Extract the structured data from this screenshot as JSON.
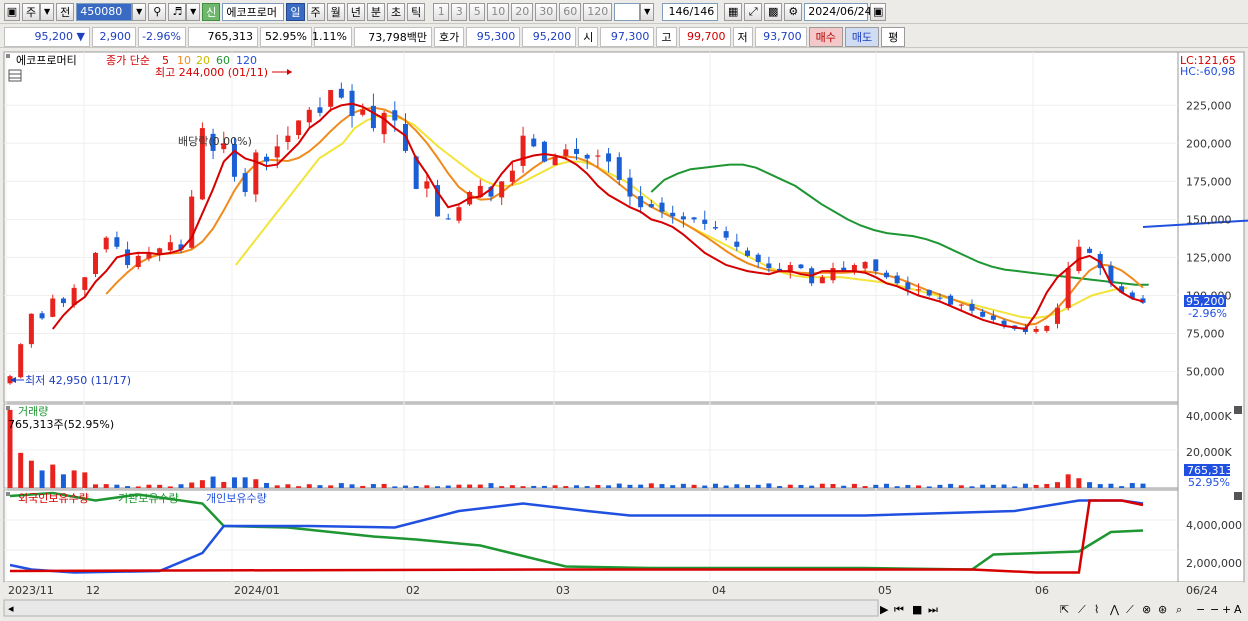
{
  "toolbar": {
    "period_btn": "주",
    "prev_btn": "전",
    "code": "450080",
    "new_badge": "신",
    "stock_name": "에코프로머",
    "periods": [
      "일",
      "주",
      "월",
      "년",
      "분",
      "초",
      "틱"
    ],
    "selected_period": "일",
    "intervals": [
      "1",
      "3",
      "5",
      "10",
      "20",
      "30",
      "60",
      "120"
    ],
    "count": "146",
    "count_total": "/146",
    "date": "2024/06/24"
  },
  "quote": {
    "price": "95,200",
    "arrow": "▼",
    "change": "2,900",
    "change_pct": "-2.96%",
    "volume": "765,313",
    "turnover_pct": "52.95%",
    "vol_ratio": "1.11%",
    "amount": "73,798백만",
    "hoga_label": "호가",
    "ask": "95,300",
    "bid": "95,200",
    "open_label": "시",
    "open": "97,300",
    "high_label": "고",
    "high": "99,700",
    "low_label": "저",
    "low": "93,700",
    "buy_btn": "매수",
    "sell_btn": "매도",
    "avg_btn": "평"
  },
  "price_panel": {
    "legend_name": "에코프로머티",
    "legend_ma_title": "종가 단순",
    "legend_ma": [
      {
        "label": "5",
        "color": "#D60000"
      },
      {
        "label": "10",
        "color": "#F08A1C"
      },
      {
        "label": "20",
        "color": "#F2E43A"
      },
      {
        "label": "60",
        "color": "#1E9632"
      },
      {
        "label": "120",
        "color": "#2050E0"
      }
    ],
    "high_note": "최고 244,000 (01/11)",
    "low_note": "최저 42,950 (11/17)",
    "div_note": "배당락(0.00%)",
    "lc": "LC:121,65",
    "hc": "HC:-60,98",
    "current_tag": "95,200",
    "current_pct": "-2.96%",
    "yticks": [
      "225,000",
      "200,000",
      "175,000",
      "150,000",
      "125,000",
      "100,000",
      "75,000",
      "50,000"
    ]
  },
  "volume_panel": {
    "title": "거래량",
    "value_note": "765,313주(52.95%)",
    "yticks": [
      "40,000K",
      "20,000K"
    ],
    "current_tag": "765,313",
    "current_pct": "52.95%"
  },
  "holdings_panel": {
    "legend": [
      {
        "label": "외국인보유수량",
        "color": "#D60000"
      },
      {
        "label": "기관보유수량",
        "color": "#1E9632"
      },
      {
        "label": "개인보유수량",
        "color": "#2050E0"
      }
    ],
    "yticks": [
      "4,000,000",
      "2,000,000"
    ]
  },
  "xaxis": {
    "labels": [
      "2023/11",
      "12",
      "2024/01",
      "02",
      "03",
      "04",
      "05",
      "06"
    ],
    "end_label": "06/24"
  },
  "chart_data": {
    "type": "candlestick",
    "title": "에코프로머티",
    "dates_range": [
      "2023/11/17",
      "2024/06/24"
    ],
    "ylim": [
      30000,
      260000
    ],
    "close": [
      47000,
      68000,
      88000,
      85000,
      98000,
      95000,
      105000,
      112000,
      128000,
      138000,
      132000,
      120000,
      126000,
      128000,
      131000,
      135000,
      130000,
      165000,
      210000,
      195000,
      200000,
      178000,
      168000,
      194000,
      188000,
      198000,
      205000,
      215000,
      222000,
      220000,
      235000,
      230000,
      218000,
      222000,
      210000,
      220000,
      215000,
      195000,
      170000,
      175000,
      152000,
      150000,
      158000,
      168000,
      172000,
      165000,
      175000,
      182000,
      205000,
      198000,
      188000,
      191000,
      196000,
      193000,
      190000,
      192000,
      188000,
      176000,
      165000,
      158000,
      158000,
      155000,
      152000,
      150000,
      150000,
      147000,
      144000,
      138000,
      132000,
      126000,
      122000,
      118000,
      116000,
      120000,
      118000,
      108000,
      112000,
      118000,
      116000,
      120000,
      122000,
      116000,
      112000,
      108000,
      104000,
      104000,
      100000,
      98000,
      94000,
      94000,
      90000,
      86000,
      84000,
      80000,
      78000,
      76000,
      78000,
      80000,
      92000,
      118000,
      132000,
      128000,
      118000,
      108000,
      102000,
      98000,
      95200
    ],
    "ma5": [
      null,
      null,
      null,
      null,
      78000,
      87000,
      94000,
      99000,
      109000,
      116000,
      125000,
      127000,
      128000,
      128000,
      127000,
      128000,
      130000,
      138000,
      154000,
      170000,
      188000,
      195000,
      190000,
      188000,
      185000,
      186000,
      193000,
      200000,
      210000,
      215000,
      222000,
      225000,
      226000,
      224000,
      220000,
      216000,
      210000,
      205000,
      190000,
      180000,
      168000,
      158000,
      160000,
      164000,
      165000,
      170000,
      180000,
      188000,
      190000,
      192000,
      193000,
      192000,
      190000,
      186000,
      180000,
      172000,
      166000,
      162000,
      158000,
      155000,
      150000,
      148000,
      145000,
      140000,
      134000,
      128000,
      124000,
      120000,
      118000,
      116000,
      115000,
      114000,
      116000,
      116000,
      114000,
      113000,
      116000,
      116000,
      116000,
      116000,
      115000,
      112000,
      108000,
      106000,
      103000,
      100000,
      98000,
      96000,
      93000,
      90000,
      87000,
      84000,
      82000,
      80000,
      79000,
      78000,
      88000,
      102000,
      112000,
      118000,
      124000,
      126000,
      122000,
      108000,
      102000,
      98000,
      96000
    ],
    "ma20": [
      null,
      null,
      null,
      null,
      null,
      null,
      null,
      null,
      null,
      null,
      null,
      null,
      null,
      null,
      null,
      null,
      null,
      null,
      null,
      120000,
      130000,
      140000,
      150000,
      160000,
      170000,
      180000,
      190000,
      195000,
      200000,
      210000,
      215000,
      218000,
      218000,
      216000,
      212000,
      205000,
      198000,
      192000,
      186000,
      180000,
      175000,
      172000,
      172000,
      174000,
      178000,
      182000,
      186000,
      188000,
      188000,
      186000,
      182000,
      178000,
      174000,
      168000,
      162000,
      156000,
      150000,
      146000,
      142000,
      138000,
      134000,
      130000,
      126000,
      122000,
      118000,
      115000,
      113000,
      112000,
      112000,
      112000,
      112000,
      111000,
      110000,
      109000,
      108000,
      106000,
      104000,
      102000,
      100000,
      98000,
      96000,
      94000,
      92000,
      90000,
      88000,
      86000,
      85000,
      86000,
      88000,
      92000,
      96000,
      100000,
      102000,
      104000,
      105000
    ],
    "ma60": [
      168000,
      176000,
      180000,
      183000,
      184000,
      185000,
      186000,
      186000,
      184000,
      180000,
      176000,
      172000,
      166000,
      160000,
      155000,
      150000,
      146000,
      143000,
      141000,
      140000,
      139000,
      137000,
      134000,
      130000,
      126000,
      122000,
      119000,
      117000,
      116000,
      115000,
      114000,
      113000,
      112000,
      111000,
      110000,
      109000,
      108000,
      107000,
      107000
    ],
    "ma120": [
      150000,
      150000,
      149000,
      148000,
      147000,
      146000,
      145000
    ]
  }
}
